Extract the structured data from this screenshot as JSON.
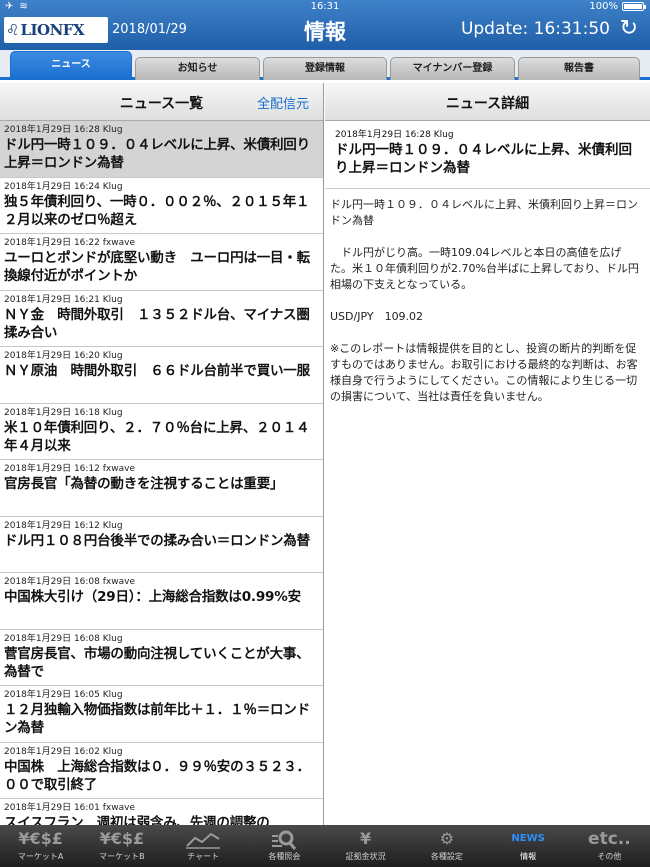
{
  "status": {
    "time": "16:31",
    "battery": "100%"
  },
  "header": {
    "logo": "LIONFX",
    "date": "2018/01/29",
    "title": "情報",
    "update": "Update: 16:31:50"
  },
  "tabs": [
    {
      "label": "ニュース",
      "active": true
    },
    {
      "label": "お知らせ",
      "active": false
    },
    {
      "label": "登録情報",
      "active": false
    },
    {
      "label": "マイナンバー登録",
      "active": false
    },
    {
      "label": "報告書",
      "active": false
    }
  ],
  "news_list": {
    "title": "ニュース一覧",
    "mark_all": "全配信元",
    "items": [
      {
        "meta": "2018年1月29日 16:28 Klug",
        "title": "ドル円一時１０９．０４レベルに上昇、米債利回り上昇＝ロンドン為替",
        "selected": true
      },
      {
        "meta": "2018年1月29日 16:24 Klug",
        "title": "独５年債利回り、一時０．００２％、２０１５年１２月以来のゼロ％超え"
      },
      {
        "meta": "2018年1月29日 16:22 fxwave",
        "title": "ユーロとポンドが底堅い動き　ユーロ円は一目・転換線付近がポイントか"
      },
      {
        "meta": "2018年1月29日 16:21 Klug",
        "title": "ＮＹ金　時間外取引　１３５２ドル台、マイナス圏揉み合い"
      },
      {
        "meta": "2018年1月29日 16:20 Klug",
        "title": "ＮＹ原油　時間外取引　６６ドル台前半で買い一服"
      },
      {
        "meta": "2018年1月29日 16:18 Klug",
        "title": "米１０年債利回り、２．７０％台に上昇、２０１４年４月以来"
      },
      {
        "meta": "2018年1月29日 16:12 fxwave",
        "title": "官房長官「為替の動きを注視することは重要」"
      },
      {
        "meta": "2018年1月29日 16:12 Klug",
        "title": "ドル円１０８円台後半での揉み合い＝ロンドン為替"
      },
      {
        "meta": "2018年1月29日 16:08 fxwave",
        "title": "中国株大引け（29日）：上海総合指数は0.99%安"
      },
      {
        "meta": "2018年1月29日 16:08 Klug",
        "title": "菅官房長官、市場の動向注視していくことが大事、為替で"
      },
      {
        "meta": "2018年1月29日 16:05 Klug",
        "title": "１２月独輸入物価指数は前年比＋１．１％＝ロンドン為替"
      },
      {
        "meta": "2018年1月29日 16:02 Klug",
        "title": "中国株　上海総合指数は０．９９％安の３５２３．００で取引終了"
      },
      {
        "meta": "2018年1月29日 16:01 fxwave",
        "title": "スイスフラン　週初は弱含み、先週の調整の"
      }
    ]
  },
  "news_detail": {
    "title": "ニュース詳細",
    "meta": "2018年1月29日 16:28 Klug",
    "headline": "ドル円一時１０９．０４レベルに上昇、米債利回り上昇＝ロンドン為替",
    "summary": "ドル円一時１０９．０４レベルに上昇、米債利回り上昇＝ロンドン為替",
    "body": "　ドル円がじり高。一時109.04レベルと本日の高値を広げた。米１０年債利回りが2.70%台半ばに上昇しており、ドル円相場の下支えとなっている。",
    "quote": "USD/JPY　109.02",
    "disclaimer": "※このレポートは情報提供を目的とし、投資の断片的判断を促すものではありません。お取引における最終的な判断は、お客様自身で行うようにしてください。この情報により生じる一切の損害について、当社は責任を負いません。"
  },
  "bottom_tabs": [
    {
      "icon": "¥€$£",
      "label": "マーケットA",
      "name": "market-a"
    },
    {
      "icon": "¥€$£",
      "label": "マーケットB",
      "name": "market-b"
    },
    {
      "icon": "📈",
      "label": "チャート",
      "name": "chart"
    },
    {
      "icon": "🔍",
      "label": "各種照会",
      "name": "inquiry"
    },
    {
      "icon": "¥",
      "label": "証拠金状況",
      "name": "margin"
    },
    {
      "icon": "⚙",
      "label": "各種設定",
      "name": "settings"
    },
    {
      "icon": "NEWS",
      "label": "情報",
      "name": "info",
      "active": true
    },
    {
      "icon": "etc..",
      "label": "その他",
      "name": "other"
    }
  ],
  "colors": {
    "header_top": "#3f82c9",
    "header_bottom": "#1f5ea8",
    "tab_active": "#1b6fd0",
    "link": "#1a6fd0"
  }
}
